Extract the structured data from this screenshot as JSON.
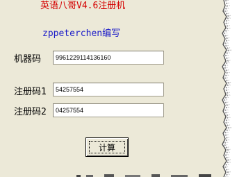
{
  "app": {
    "title": "英语八哥V4.6注册机",
    "subtitle": "zppeterchen编写"
  },
  "form": {
    "machine_code": {
      "label": "机器码",
      "value": "9961229114136160"
    },
    "reg_code_1": {
      "label": "注册码1",
      "value": "54257554"
    },
    "reg_code_2": {
      "label": "注册码2",
      "value": "04257554"
    }
  },
  "actions": {
    "calculate_label": "计算"
  },
  "colors": {
    "title": "#d40000",
    "subtitle": "#1a1ac8",
    "background": "#ece9d8"
  }
}
